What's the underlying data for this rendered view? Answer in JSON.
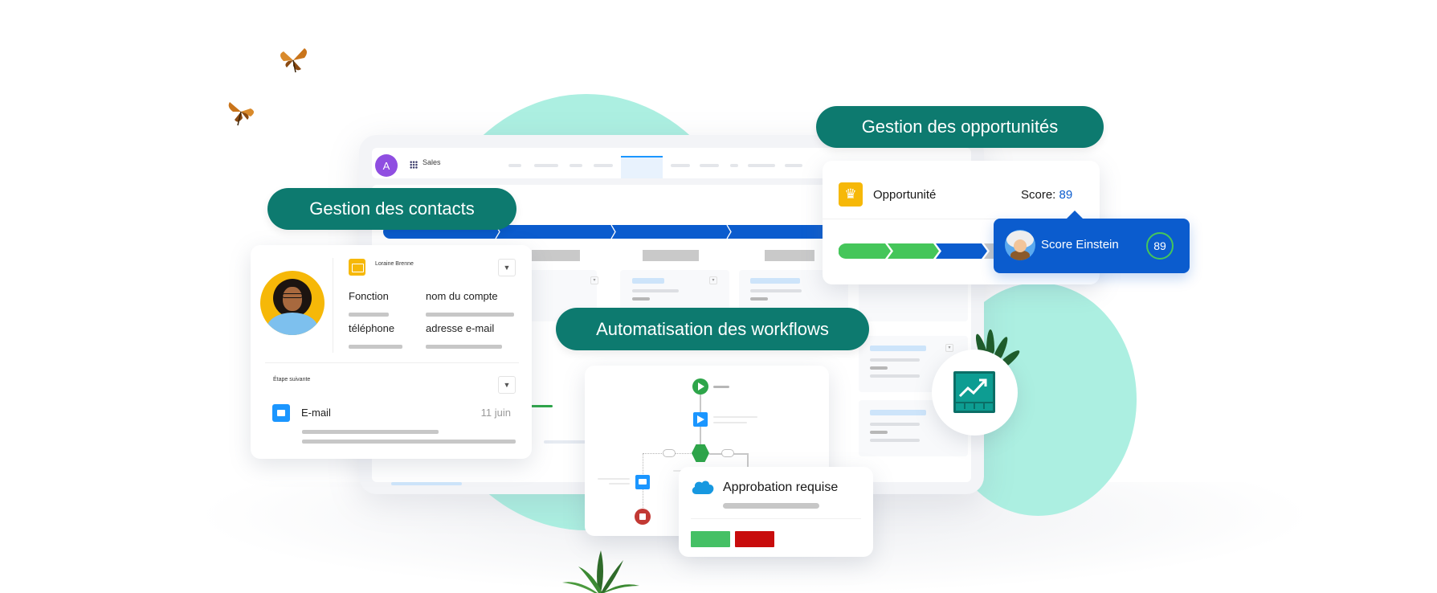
{
  "app_window": {
    "avatar_initial": "A",
    "app_name": "Sales"
  },
  "pills": {
    "contacts": "Gestion des contacts",
    "opportunities": "Gestion des opportunités",
    "workflows": "Automatisation des workflows"
  },
  "contact_card": {
    "name": "Loraine Brenne",
    "fields": [
      {
        "label": "Fonction"
      },
      {
        "label": "nom du compte"
      },
      {
        "label": "téléphone"
      },
      {
        "label": "adresse e-mail"
      }
    ],
    "next_step_label": "Étape suivante",
    "next_step": {
      "type": "E-mail",
      "date": "11 juin"
    }
  },
  "opportunity_card": {
    "title": "Opportunité",
    "score_label": "Score:",
    "score_value": "89",
    "stages_completed": 2,
    "stages_current": 1,
    "stages_total": 4
  },
  "einstein_card": {
    "label": "Score Einstein",
    "score": "89"
  },
  "approval_card": {
    "title": "Approbation requise"
  },
  "colors": {
    "pill_teal": "#0d7a6f",
    "brand_blue": "#0b5cce",
    "success_green": "#45c065",
    "danger_red": "#c80c0c",
    "mint": "#acefe1",
    "contact_yellow": "#f6b808"
  }
}
